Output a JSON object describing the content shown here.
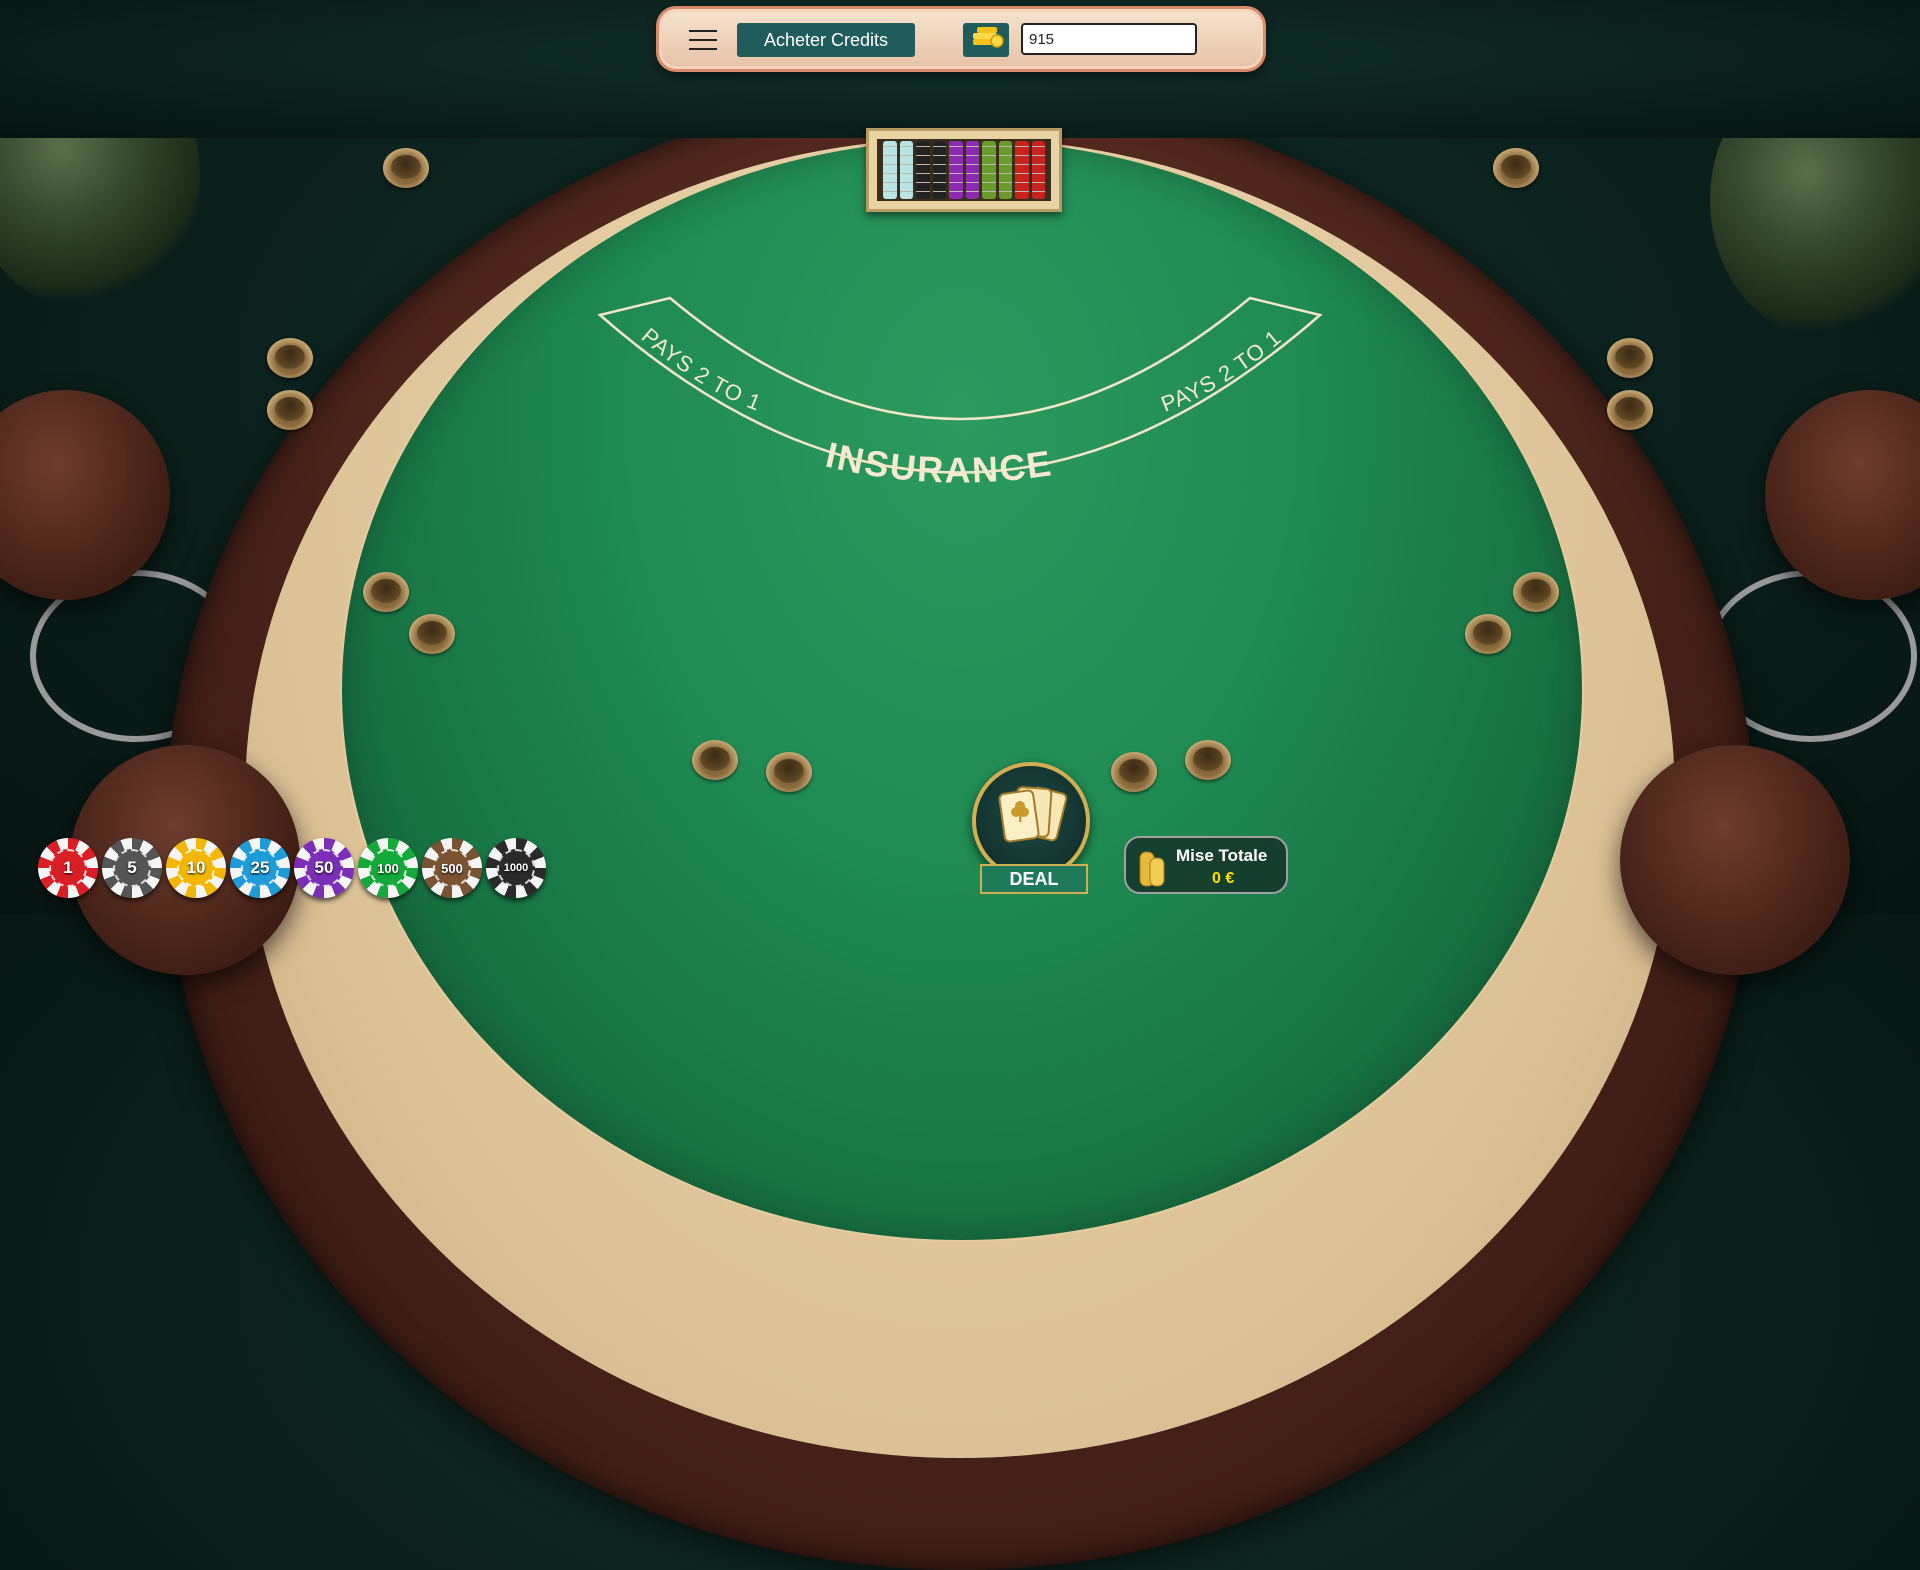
{
  "topbar": {
    "menu_icon": "hamburger-icon",
    "buy_credits_label": "Acheter Credits",
    "coin_icon": "coins-icon",
    "credits_value": "915"
  },
  "table": {
    "insurance_label": "INSURANCE",
    "pays_left": "PAYS 2 TO 1",
    "pays_right": "PAYS 2 TO 1"
  },
  "chips": [
    {
      "label": "1",
      "color": "#d81f26"
    },
    {
      "label": "5",
      "color": "#555555"
    },
    {
      "label": "10",
      "color": "#f2b705"
    },
    {
      "label": "25",
      "color": "#1f9bd8"
    },
    {
      "label": "50",
      "color": "#7b2fb6"
    },
    {
      "label": "100",
      "color": "#15a83a"
    },
    {
      "label": "500",
      "color": "#7a5432"
    },
    {
      "label": "1000",
      "color": "#2a2a2a"
    }
  ],
  "deal": {
    "label": "DEAL",
    "icon": "cards-icon"
  },
  "bet": {
    "title": "Mise Totale",
    "value": "0 €",
    "icon": "coin-stack-icon"
  }
}
